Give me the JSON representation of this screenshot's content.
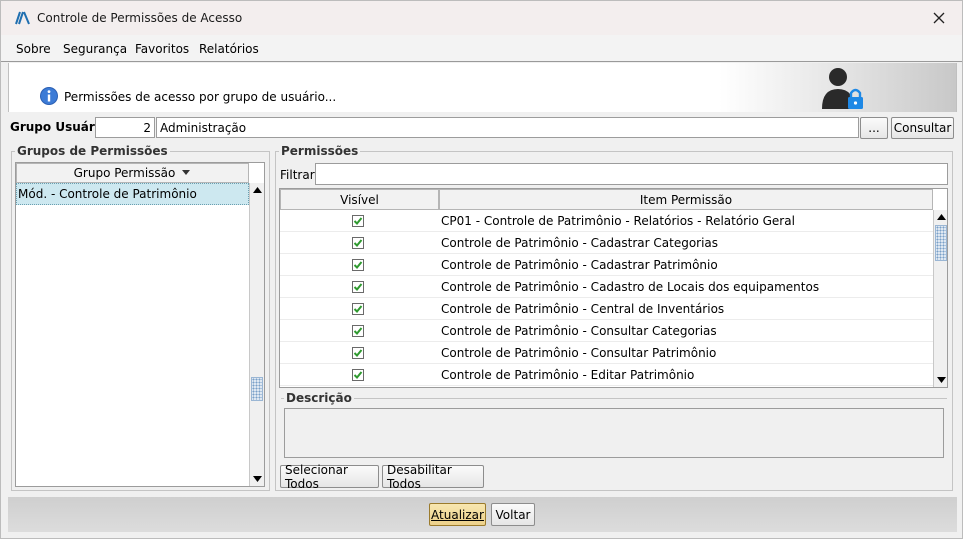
{
  "window": {
    "title": "Controle de Permissões de Acesso"
  },
  "menu": {
    "items": [
      "Sobre",
      "Segurança",
      "Favoritos",
      "Relatórios"
    ]
  },
  "banner": {
    "text": "Permissões de acesso por grupo de usuário..."
  },
  "user_group": {
    "label": "Grupo Usuário:",
    "id_value": "2",
    "name_value": "Administração",
    "browse_label": "...",
    "consult_label": "Consultar"
  },
  "permission_groups": {
    "title": "Grupos de Permissões",
    "column_header": "Grupo Permissão",
    "items": [
      "Mód. - Controle de Patrimônio"
    ]
  },
  "permissions": {
    "title": "Permissões",
    "filter_label": "Filtrar:",
    "filter_value": "",
    "col_visible": "Visível",
    "col_item": "Item Permissão",
    "rows": [
      {
        "visible": true,
        "item": "CP01 - Controle de Patrimônio - Relatórios - Relatório Geral"
      },
      {
        "visible": true,
        "item": "Controle de Patrimônio - Cadastrar Categorias"
      },
      {
        "visible": true,
        "item": "Controle de Patrimônio - Cadastrar Patrimônio"
      },
      {
        "visible": true,
        "item": "Controle de Patrimônio - Cadastro de Locais dos equipamentos"
      },
      {
        "visible": true,
        "item": "Controle de Patrimônio - Central de Inventários"
      },
      {
        "visible": true,
        "item": "Controle de Patrimônio - Consultar Categorias"
      },
      {
        "visible": true,
        "item": "Controle de Patrimônio - Consultar Patrimônio"
      },
      {
        "visible": true,
        "item": "Controle de Patrimônio - Editar Patrimônio"
      }
    ],
    "description_label": "Descrição",
    "select_all_label": "Selecionar Todos",
    "disable_all_label": "Desabilitar Todos"
  },
  "footer": {
    "update_label": "Atualizar",
    "back_label": "Voltar"
  },
  "colors": {
    "check": "#2f9a2f",
    "selection": "#cde8f0",
    "update_button": "#f3dfa0"
  },
  "icons": [
    "app-logo-icon",
    "close-icon",
    "info-icon",
    "user-lock-icon",
    "sort-down-icon",
    "scroll-up-icon",
    "scroll-down-icon",
    "checkmark-icon"
  ]
}
